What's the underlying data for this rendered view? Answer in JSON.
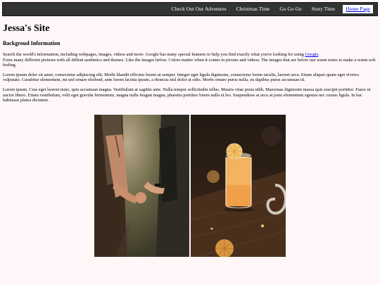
{
  "nav": {
    "items": [
      {
        "label": "Check Out Our Advetures"
      },
      {
        "label": "Christmas Time"
      },
      {
        "label": "Go Go Go"
      },
      {
        "label": "Story Time"
      },
      {
        "label": "Home Page"
      }
    ]
  },
  "page": {
    "title": "Jessa's Site",
    "section_heading": "Backgroud Information",
    "para1_before_link": "Search the world's information, including webpages, images, videos and more. Google has many special features to help you find exactly what you're looking for using ",
    "para1_link": "Google",
    "para1_after_link": ".",
    "para1_line2": "Form many different pictures with all diffent aesthetics and themes. Like the images below. Colors matter when it comes to picture and videos. The images that are below use warm tones to make a warm soft feeling.",
    "para2": "Lorem ipsum dolor sit amet, consectetur adipiscing elit. Morbi blandit efficitur lorem ut semper. Integer eget ligula dignissim, consectetur lorem iaculis, laoreet arcu. Etiam aliquet quam eget viverra vulputate. Curabitur elementum, mi sed ornare eleifend, ante lorem lacinia ipsum, a rhoncus nisl dolor at odio. Morbi ornare purus nulla, eu dapibus purus accumsan id.",
    "para3": "Lorem ipsum. Cras eget laoreet nunc, quis accumsan magna. Vestibulum at sagittis ante. Nulla tempor sollicitudin tellus. Mauris vitae porta nibh. Maecenas dignissim massa quis suscipit porttitor. Fusce ut auctor libero. Etiam vestibulum, velit eget gravida fermentum, magna nulla feugiat magna, pharetra porttitor lorem nulla et leo. Suspendisse at arcu at justo elementum egestas nec cursus ligula. In hac habitasse platea dictumst."
  },
  "colors": {
    "nav_bg": "#333333",
    "page_bg": "#fff7f7",
    "link": "#0000ee"
  }
}
